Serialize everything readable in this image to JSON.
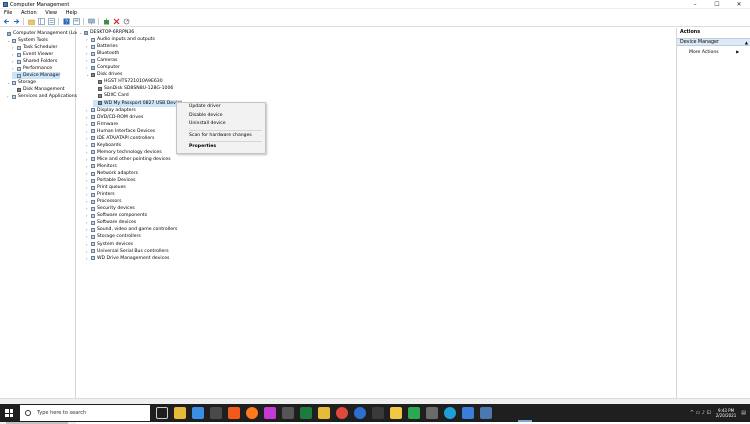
{
  "window": {
    "title": "Computer Management",
    "buttons": [
      "–",
      "☐",
      "✕"
    ]
  },
  "menu": [
    "File",
    "Action",
    "View",
    "Help"
  ],
  "left_tree": [
    {
      "label": "Computer Management (Local",
      "level": 0,
      "icon": "computer-management-icon",
      "expander": ""
    },
    {
      "label": "System Tools",
      "level": 1,
      "icon": "tools-icon",
      "expander": "v"
    },
    {
      "label": "Task Scheduler",
      "level": 2,
      "icon": "task-scheduler-icon",
      "expander": ">"
    },
    {
      "label": "Event Viewer",
      "level": 2,
      "icon": "event-viewer-icon",
      "expander": ">"
    },
    {
      "label": "Shared Folders",
      "level": 2,
      "icon": "shared-folders-icon",
      "expander": ">"
    },
    {
      "label": "Performance",
      "level": 2,
      "icon": "performance-icon",
      "expander": ">"
    },
    {
      "label": "Device Manager",
      "level": 2,
      "icon": "device-manager-icon",
      "expander": "",
      "selected": true
    },
    {
      "label": "Storage",
      "level": 1,
      "icon": "storage-icon",
      "expander": "v"
    },
    {
      "label": "Disk Management",
      "level": 2,
      "icon": "disk-management-icon",
      "expander": ""
    },
    {
      "label": "Services and Applications",
      "level": 1,
      "icon": "services-icon",
      "expander": ">"
    }
  ],
  "device_tree": [
    {
      "label": "DESKTOP-6RRPN36",
      "level": 0,
      "expander": "v",
      "icon": "computer-icon"
    },
    {
      "label": "Audio inputs and outputs",
      "level": 1,
      "expander": ">",
      "icon": "audio-icon"
    },
    {
      "label": "Batteries",
      "level": 1,
      "expander": ">",
      "icon": "battery-icon"
    },
    {
      "label": "Bluetooth",
      "level": 1,
      "expander": ">",
      "icon": "bluetooth-icon"
    },
    {
      "label": "Cameras",
      "level": 1,
      "expander": ">",
      "icon": "camera-icon"
    },
    {
      "label": "Computer",
      "level": 1,
      "expander": ">",
      "icon": "computer-icon"
    },
    {
      "label": "Disk drives",
      "level": 1,
      "expander": "v",
      "icon": "disk-icon"
    },
    {
      "label": "HGST HTS721010A9E630",
      "level": 2,
      "expander": "",
      "icon": "disk-icon"
    },
    {
      "label": "SanDisk SD8SN8U-128G-1006",
      "level": 2,
      "expander": "",
      "icon": "disk-icon"
    },
    {
      "label": "SDXC Card",
      "level": 2,
      "expander": "",
      "icon": "disk-icon"
    },
    {
      "label": "WD My Passport 0827 USB Device",
      "level": 2,
      "expander": "",
      "icon": "disk-icon",
      "selected": true
    },
    {
      "label": "Display adapters",
      "level": 1,
      "expander": ">",
      "icon": "display-icon"
    },
    {
      "label": "DVD/CD-ROM drives",
      "level": 1,
      "expander": ">",
      "icon": "dvd-icon"
    },
    {
      "label": "Firmware",
      "level": 1,
      "expander": ">",
      "icon": "firmware-icon"
    },
    {
      "label": "Human Interface Devices",
      "level": 1,
      "expander": ">",
      "icon": "hid-icon"
    },
    {
      "label": "IDE ATA/ATAPI controllers",
      "level": 1,
      "expander": ">",
      "icon": "ide-icon"
    },
    {
      "label": "Keyboards",
      "level": 1,
      "expander": ">",
      "icon": "keyboard-icon"
    },
    {
      "label": "Memory technology devices",
      "level": 1,
      "expander": ">",
      "icon": "memory-icon"
    },
    {
      "label": "Mice and other pointing devices",
      "level": 1,
      "expander": ">",
      "icon": "mouse-icon"
    },
    {
      "label": "Monitors",
      "level": 1,
      "expander": ">",
      "icon": "monitor-icon"
    },
    {
      "label": "Network adapters",
      "level": 1,
      "expander": ">",
      "icon": "network-icon"
    },
    {
      "label": "Portable Devices",
      "level": 1,
      "expander": ">",
      "icon": "portable-icon"
    },
    {
      "label": "Print queues",
      "level": 1,
      "expander": ">",
      "icon": "print-queue-icon"
    },
    {
      "label": "Printers",
      "level": 1,
      "expander": ">",
      "icon": "printer-icon"
    },
    {
      "label": "Processors",
      "level": 1,
      "expander": ">",
      "icon": "processor-icon"
    },
    {
      "label": "Security devices",
      "level": 1,
      "expander": ">",
      "icon": "security-icon"
    },
    {
      "label": "Software components",
      "level": 1,
      "expander": ">",
      "icon": "software-component-icon"
    },
    {
      "label": "Software devices",
      "level": 1,
      "expander": ">",
      "icon": "software-device-icon"
    },
    {
      "label": "Sound, video and game controllers",
      "level": 1,
      "expander": ">",
      "icon": "sound-icon"
    },
    {
      "label": "Storage controllers",
      "level": 1,
      "expander": ">",
      "icon": "storage-controller-icon"
    },
    {
      "label": "System devices",
      "level": 1,
      "expander": ">",
      "icon": "system-devices-icon"
    },
    {
      "label": "Universal Serial Bus controllers",
      "level": 1,
      "expander": ">",
      "icon": "usb-icon"
    },
    {
      "label": "WD Drive Management devices",
      "level": 1,
      "expander": ">",
      "icon": "wd-icon"
    }
  ],
  "context_menu": {
    "update": "Update driver",
    "disable": "Disable device",
    "uninstall": "Uninstall device",
    "scan": "Scan for hardware changes",
    "properties": "Properties"
  },
  "actions": {
    "header": "Actions",
    "section": "Device Manager",
    "more": "More Actions",
    "arrow_up": "▲",
    "arrow_right": "▶"
  },
  "taskbar": {
    "search_placeholder": "Type here to search",
    "time": "9:43 PM",
    "date": "2/20/2021",
    "tray_text": "^  ▭  ♪  ⊡"
  }
}
